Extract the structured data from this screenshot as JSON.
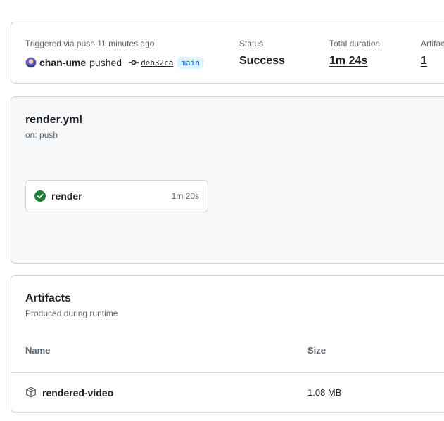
{
  "summary": {
    "triggered_text": "Triggered via push 11 minutes ago",
    "actor": "chan-ume",
    "action": "pushed",
    "commit_sha": "deb32ca",
    "branch": "main",
    "status_label": "Status",
    "status_value": "Success",
    "duration_label": "Total duration",
    "duration_value": "1m 24s",
    "artifacts_label": "Artifacts",
    "artifacts_value": "1"
  },
  "workflow": {
    "file_name": "render.yml",
    "trigger": "on: push",
    "jobs": [
      {
        "name": "render",
        "duration": "1m 20s",
        "status": "success"
      }
    ]
  },
  "artifacts": {
    "title": "Artifacts",
    "subtitle": "Produced during runtime",
    "columns": {
      "name": "Name",
      "size": "Size"
    },
    "rows": [
      {
        "name": "rendered-video",
        "size": "1.08 MB"
      }
    ]
  },
  "colors": {
    "success": "#1a7f37",
    "link": "#0969da",
    "branch_bg": "#ddf4ff",
    "border": "#d0d7de",
    "muted": "#59636e",
    "graph_bg": "#f6f8fa"
  },
  "icons": {
    "commit": "git-commit-icon",
    "success": "check-circle-fill-icon",
    "artifact": "package-icon"
  }
}
